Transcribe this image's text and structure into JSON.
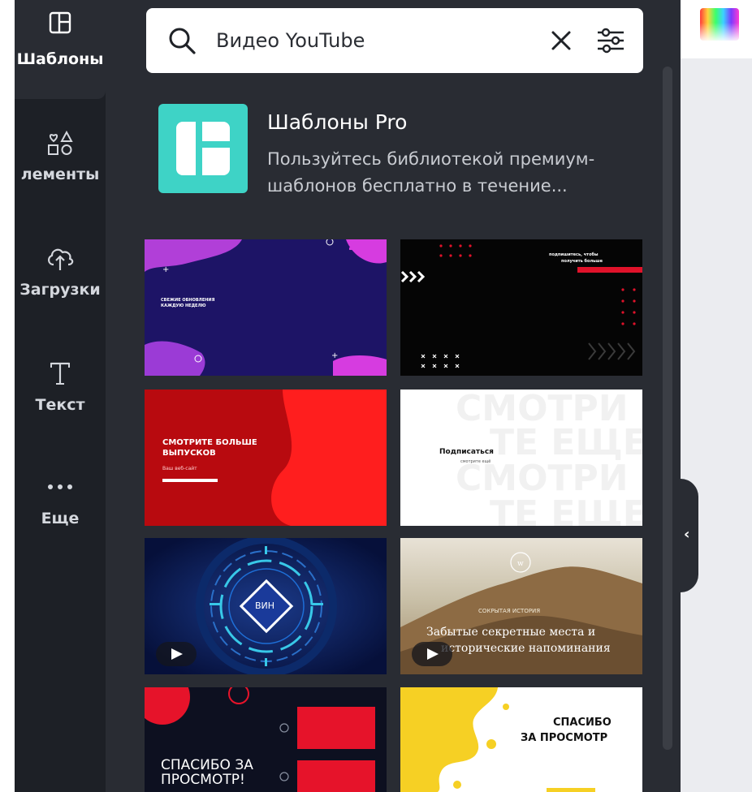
{
  "sidebar": {
    "items": [
      {
        "label": "Шаблоны",
        "icon": "templates-icon"
      },
      {
        "label": "лементы",
        "icon": "elements-icon"
      },
      {
        "label": "Загрузки",
        "icon": "upload-cloud-icon"
      },
      {
        "label": "Текст",
        "icon": "text-icon"
      },
      {
        "label": "Еще",
        "icon": "more-dots-icon"
      }
    ]
  },
  "search": {
    "value": "Видео YouTube",
    "placeholder": "Видео YouTube"
  },
  "promo": {
    "title": "Шаблоны Pro",
    "description": "Пользуйтесь библиотекой премиум-шаблонов бесплатно в течение..."
  },
  "templates": [
    {
      "texts": [
        "СВЕЖИЕ ОБНОВЛЕНИЯ",
        "КАЖДУЮ НЕДЕЛЮ"
      ],
      "colors": {
        "bg": "#1d1466",
        "accent": "#d63ce0"
      }
    },
    {
      "texts": [
        "подпишитесь, чтобы",
        "получить больше"
      ],
      "colors": {
        "bg": "#050505",
        "accent": "#e0122a"
      }
    },
    {
      "texts": [
        "СМОТРИТЕ БОЛЬШЕ",
        "ВЫПУСКОВ",
        "Ваш веб-сайт"
      ],
      "colors": {
        "bg": "#b80a0f",
        "accent": "#ff1e1e"
      }
    },
    {
      "texts": [
        "Подписаться",
        "смотрите ещё",
        "СМОТРИ",
        "ТЕ ЕЩЕ"
      ],
      "colors": {
        "bg": "#ffffff",
        "accent": "#f1f1f1"
      }
    },
    {
      "texts": [
        "ВИН"
      ],
      "colors": {
        "bg": "#0a1a4a",
        "accent": "#38c8e8"
      }
    },
    {
      "texts": [
        "СОКРЫТАЯ ИСТОРИЯ",
        "Забытые секретные места и",
        "исторические напоминания"
      ],
      "colors": {
        "bg": "#7d6a4a",
        "accent": "#e8e2d6"
      }
    },
    {
      "texts": [
        "СПАСИБО ЗА",
        "ПРОСМОТР!"
      ],
      "colors": {
        "bg": "#0d1020",
        "accent": "#e6132a"
      }
    },
    {
      "texts": [
        "СПАСИБО",
        "ЗА ПРОСМОТР"
      ],
      "colors": {
        "bg": "#ffffff",
        "accent": "#f6d024"
      }
    }
  ],
  "colors": {
    "rail_bg": "#1d2026",
    "panel_bg": "#292c33",
    "promo_tile": "#3ed3c6",
    "canvas_bg": "#ebecf0"
  }
}
